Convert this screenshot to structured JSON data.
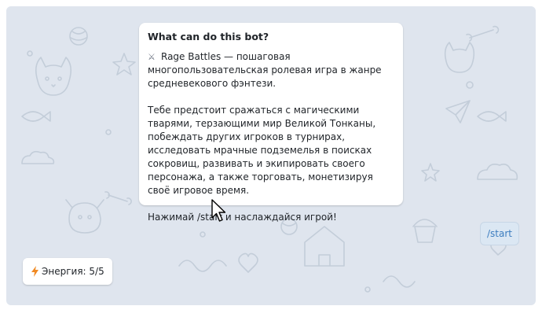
{
  "bot_info": {
    "title": "What can do this bot?",
    "intro_icon": "crossed-swords-icon",
    "intro_icon_glyph": "⚔",
    "intro_text": "Rage Battles — пошаговая многопользовательская ролевая игра в жанре средневекового фэнтези.",
    "body_text": "Тебе предстоит сражаться с магическими тварями, терзающими мир Великой Тонканы, побеждать других игроков в турнирах, исследовать мрачные подземелья в поисках сокровищ, развивать и экипировать своего персонажа, а также торговать, монетизируя своё игровое время.",
    "call_to_action": "Нажимай /start и наслаждайся игрой!"
  },
  "start_button": {
    "label": "/start"
  },
  "energy_badge": {
    "icon": "lightning-icon",
    "label": "Энергия: 5/5"
  },
  "colors": {
    "chat_background": "#dfe5ee",
    "doodle_stroke": "#c3cdd9",
    "card_background": "#ffffff",
    "start_button_text": "#3c7dbf",
    "bolt": "#f08a24"
  }
}
